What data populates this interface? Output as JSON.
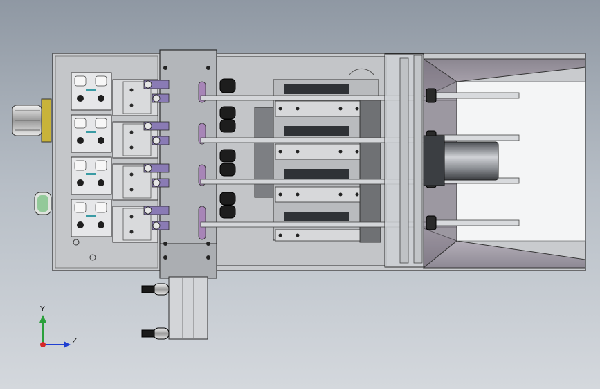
{
  "view": {
    "triad": {
      "y_label": "Y",
      "z_label": "Z"
    }
  },
  "colors": {
    "background_top": "#8f98a3",
    "background_bottom": "#d4d8dd",
    "plate": "#c9cbce",
    "block": "#b6b9bd",
    "dark": "#2c2f33",
    "accent_purple": "#8a7bb5",
    "axis_y": "#2aa03b",
    "axis_z": "#1f3fd1",
    "axis_x": "#d62828"
  }
}
